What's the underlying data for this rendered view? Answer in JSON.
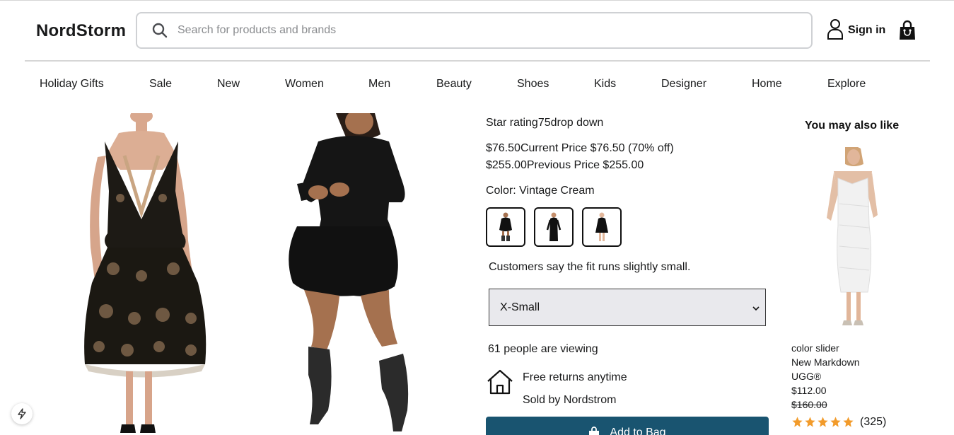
{
  "header": {
    "logo": "NordStorm",
    "search_placeholder": "Search for products and brands",
    "signin_label": "Sign in"
  },
  "nav": {
    "items": [
      "Holiday Gifts",
      "Sale",
      "New",
      "Women",
      "Men",
      "Beauty",
      "Shoes",
      "Kids",
      "Designer",
      "Home",
      "Explore"
    ]
  },
  "product": {
    "rating_text": "Star rating75drop down",
    "current_price": "$76.50Current Price $76.50 (70% off)",
    "previous_price": "$255.00Previous Price $255.00",
    "color_label": "Color: Vintage Cream",
    "fit_note": "Customers say the fit runs slightly small.",
    "size_selected": "X-Small",
    "viewing": "61 people are viewing",
    "returns": "Free returns anytime",
    "sold_by": "Sold by Nordstrom",
    "add_to_bag": "Add to Bag"
  },
  "recommendations": {
    "heading": "You may also like",
    "item": {
      "tag": "color slider",
      "badge": "New Markdown",
      "brand": "UGG®",
      "price": "$112.00",
      "original_price": "$160.00",
      "rating": 5,
      "reviews": "(325)"
    }
  },
  "colors": {
    "accent": "#195470",
    "star": "#f29b2b",
    "border": "#cfd1d4"
  }
}
